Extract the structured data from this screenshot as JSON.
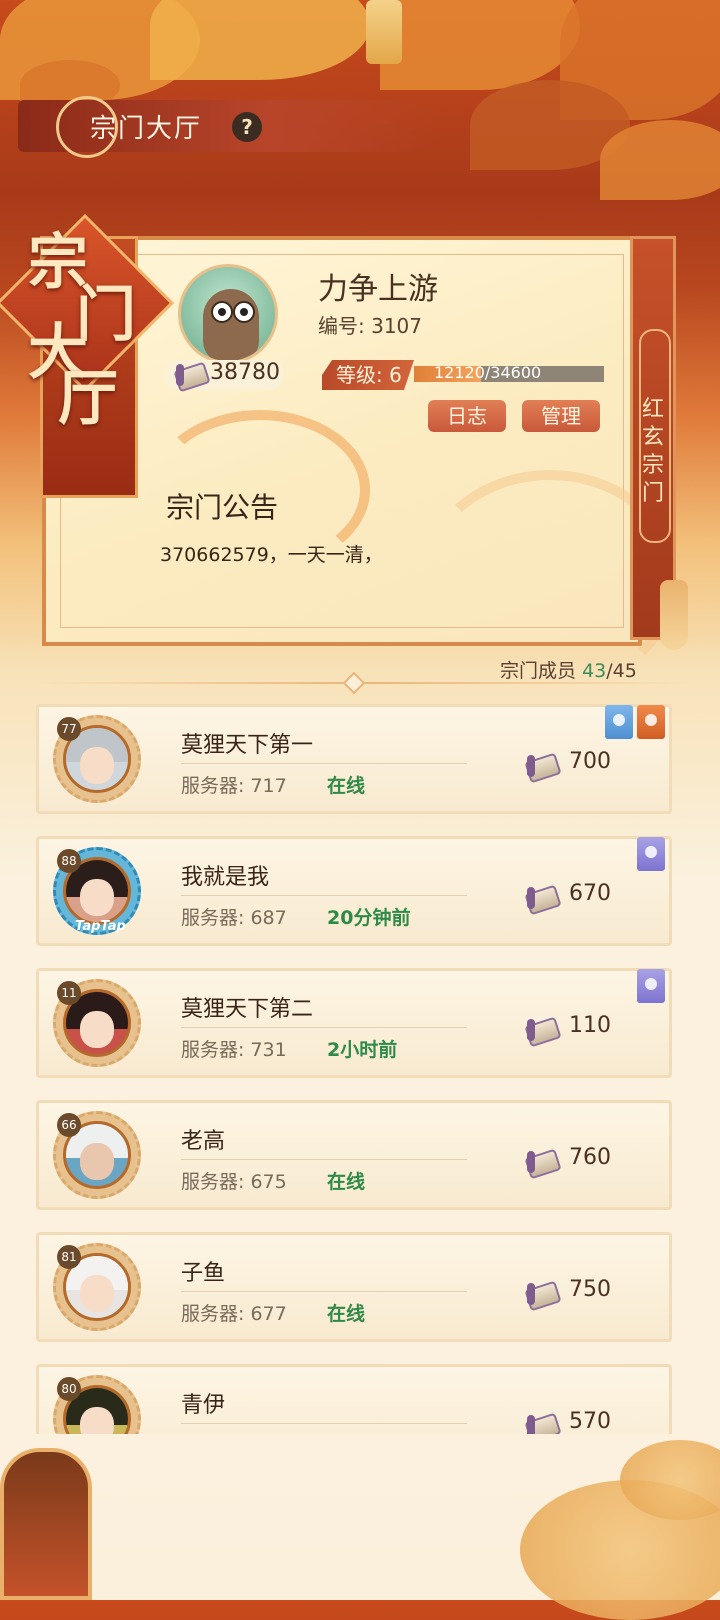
{
  "header": {
    "title": "宗门大厅",
    "help_label": "?"
  },
  "badge": {
    "chars": [
      "宗",
      "门",
      "大",
      "厅"
    ]
  },
  "side_plaque": {
    "chars": [
      "红",
      "玄",
      "宗",
      "门"
    ]
  },
  "sect": {
    "name": "力争上游",
    "id_text": "编号: 3107",
    "contribution_total": "38780",
    "level_text": "等级: 6",
    "exp_text": "12120/34600",
    "exp_fraction": 0.35,
    "log_button": "日志",
    "manage_button": "管理"
  },
  "notice": {
    "title": "宗门公告",
    "text": "370662579，一天一清，"
  },
  "members_header": {
    "label": "宗门成员",
    "count": "43",
    "total": "/45"
  },
  "members": [
    {
      "level": "77",
      "name": "莫狸天下第一",
      "server": "服务器: 717",
      "status": "在线",
      "contribution": "700",
      "marks": [
        "blue",
        "orange"
      ]
    },
    {
      "level": "88",
      "name": "我就是我",
      "server": "服务器: 687",
      "status": "20分钟前",
      "contribution": "670",
      "marks": [
        "purple"
      ]
    },
    {
      "level": "11",
      "name": "莫狸天下第二",
      "server": "服务器: 731",
      "status": "2小时前",
      "contribution": "110",
      "marks": [
        "purple"
      ]
    },
    {
      "level": "66",
      "name": "老高",
      "server": "服务器: 675",
      "status": "在线",
      "contribution": "760",
      "marks": []
    },
    {
      "level": "81",
      "name": "子鱼",
      "server": "服务器: 677",
      "status": "在线",
      "contribution": "750",
      "marks": []
    },
    {
      "level": "80",
      "name": "青伊",
      "server": "",
      "status": "",
      "contribution": "570",
      "marks": []
    }
  ],
  "avatar_frame_text": "TapTap",
  "colors": {
    "accent_red": "#b8452a",
    "online_green": "#2e8a48",
    "panel_cream": "#fcebc0"
  }
}
